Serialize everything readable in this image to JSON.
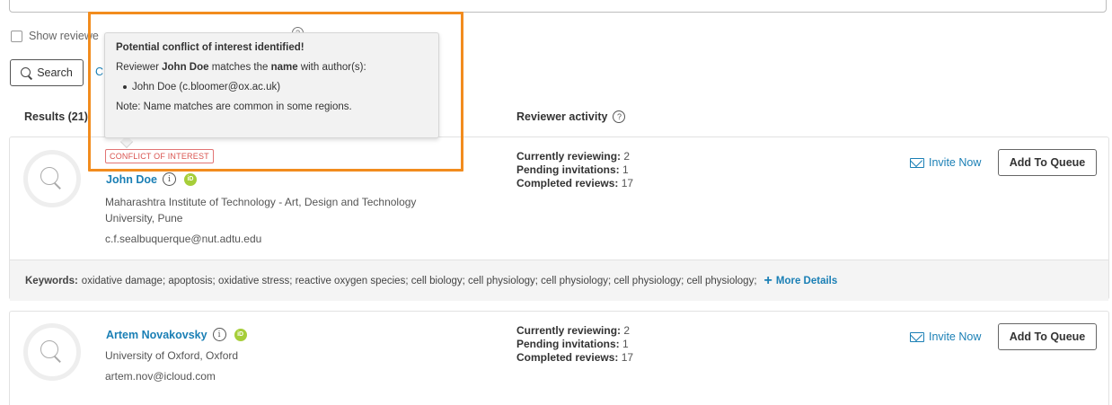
{
  "filters": {
    "show_reviewers_label": "Show reviewe",
    "search_label": "Search",
    "clear_peek": "C"
  },
  "results": {
    "header": "Results (21)",
    "activity_header": "Reviewer activity"
  },
  "tooltip": {
    "title": "Potential conflict of interest identified!",
    "line_prefix": "Reviewer ",
    "line_reviewer": "John Doe",
    "line_mid": " matches the ",
    "line_field": "name",
    "line_suffix": " with author(s):",
    "author": "John Doe (c.bloomer@ox.ac.uk)",
    "note": "Note: Name matches are common in some regions."
  },
  "reviewers": [
    {
      "badge": "CONFLICT OF INTEREST",
      "name": "John Doe",
      "affiliation_line1": "Maharashtra Institute of Technology - Art, Design and Technology",
      "affiliation_line2": "University, Pune",
      "email": "c.f.sealbuquerque@nut.adtu.edu",
      "currently_label": "Currently reviewing:",
      "currently_value": " 2",
      "pending_label": "Pending invitations:",
      "pending_value": " 1",
      "completed_label": "Completed reviews:",
      "completed_value": " 17",
      "invite_label": "Invite Now",
      "queue_label": "Add To Queue",
      "keywords_label": "Keywords:",
      "keywords": "oxidative damage; apoptosis; oxidative stress; reactive oxygen species; cell biology; cell physiology; cell physiology; cell physiology; cell physiology;",
      "more_details": "More Details"
    },
    {
      "name": "Artem Novakovsky",
      "affiliation_line1": "University of Oxford, Oxford",
      "email": "artem.nov@icloud.com",
      "currently_label": "Currently reviewing:",
      "currently_value": " 2",
      "pending_label": "Pending invitations:",
      "pending_value": " 1",
      "completed_label": "Completed reviews:",
      "completed_value": " 17",
      "invite_label": "Invite Now",
      "queue_label": "Add To Queue"
    }
  ],
  "icons": {
    "search": "magnifier-icon",
    "info": "info-icon",
    "orcid": "orcid-icon",
    "invite": "envelope-icon",
    "help": "question-icon"
  },
  "colors": {
    "accent": "#1a7fb5",
    "highlight": "#f28c1e",
    "conflict": "#d9534f",
    "orcid": "#a6ce39"
  }
}
